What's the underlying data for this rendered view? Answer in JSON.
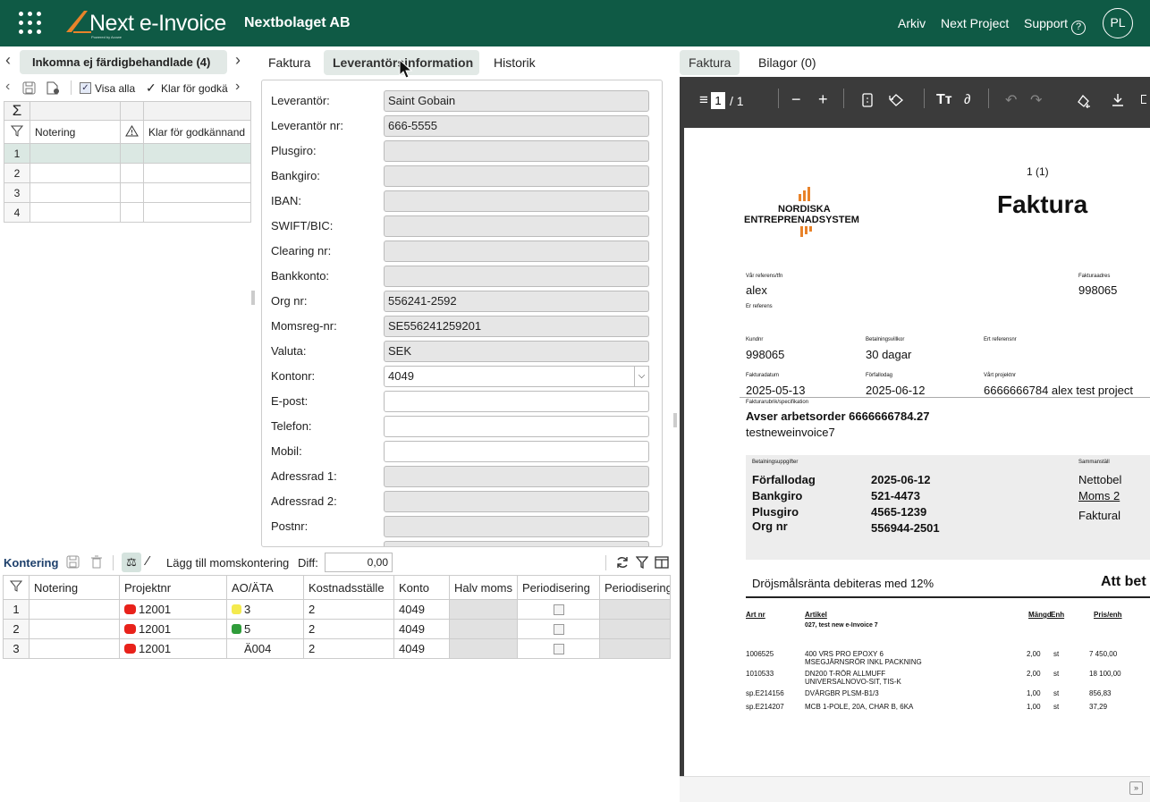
{
  "topbar": {
    "brand": "Next e-Invoice",
    "powered": "Powered by Acowe",
    "company": "Nextbolaget AB",
    "nav": [
      "Arkiv",
      "Next Project",
      "Support"
    ],
    "support_icon": "?",
    "avatar": "PL"
  },
  "left": {
    "tab_label": "Inkomna ej färdigbehandlade (4)",
    "visa_alla": "Visa alla",
    "klar": "Klar för godkä",
    "col_notering": "Notering",
    "col_klar": "Klar för godkännand",
    "sigma": "Σ",
    "rows": [
      "1",
      "2",
      "3",
      "4"
    ]
  },
  "mid": {
    "tabs": [
      "Faktura",
      "Leverantörsinformation",
      "Historik"
    ],
    "fields": [
      {
        "label": "Leverantör:",
        "value": "Saint Gobain",
        "style": "grey"
      },
      {
        "label": "Leverantör nr:",
        "value": "666-5555",
        "style": "grey"
      },
      {
        "label": "Plusgiro:",
        "value": "",
        "style": "grey"
      },
      {
        "label": "Bankgiro:",
        "value": "",
        "style": "grey"
      },
      {
        "label": "IBAN:",
        "value": "",
        "style": "grey"
      },
      {
        "label": "SWIFT/BIC:",
        "value": "",
        "style": "grey"
      },
      {
        "label": "Clearing nr:",
        "value": "",
        "style": "grey"
      },
      {
        "label": "Bankkonto:",
        "value": "",
        "style": "grey"
      },
      {
        "label": "Org nr:",
        "value": "556241-2592",
        "style": "grey"
      },
      {
        "label": "Momsreg-nr:",
        "value": "SE556241259201",
        "style": "grey"
      },
      {
        "label": "Valuta:",
        "value": "SEK",
        "style": "grey"
      },
      {
        "label": "Kontonr:",
        "value": "4049",
        "style": "select"
      },
      {
        "label": "E-post:",
        "value": "",
        "style": "white"
      },
      {
        "label": "Telefon:",
        "value": "",
        "style": "white"
      },
      {
        "label": "Mobil:",
        "value": "",
        "style": "white"
      },
      {
        "label": "Adressrad 1:",
        "value": "",
        "style": "grey"
      },
      {
        "label": "Adressrad 2:",
        "value": "",
        "style": "grey"
      },
      {
        "label": "Postnr:",
        "value": "",
        "style": "grey"
      },
      {
        "label": "Ort:",
        "value": "",
        "style": "grey"
      }
    ]
  },
  "kontering": {
    "title": "Kontering",
    "add_moms": "Lägg till momskontering",
    "diff_label": "Diff:",
    "diff_value": "0,00",
    "headers": [
      "Notering",
      "Projektnr",
      "AO/ÄTA",
      "Kostnadsställe",
      "Konto",
      "Halv moms",
      "Periodisering",
      "Periodisering"
    ],
    "rows": [
      {
        "n": "1",
        "projekt": "12001",
        "projekt_color": "#e8221b",
        "ao": "3",
        "ao_color": "#f4ea4e",
        "kost": "2",
        "konto": "4049"
      },
      {
        "n": "2",
        "projekt": "12001",
        "projekt_color": "#e8221b",
        "ao": "5",
        "ao_color": "#2f9c3a",
        "kost": "2",
        "konto": "4049"
      },
      {
        "n": "3",
        "projekt": "12001",
        "projekt_color": "#e8221b",
        "ao": "Ä004",
        "ao_color": "",
        "kost": "2",
        "konto": "4049"
      }
    ]
  },
  "right": {
    "tabs": [
      "Faktura",
      "Bilagor (0)"
    ],
    "viewer": {
      "page_current": "1",
      "page_total": "/ 1"
    },
    "invoice": {
      "page_of": "1 (1)",
      "title": "Faktura",
      "logo_line1": "NORDISKA",
      "logo_line2": "ENTREPRENADSYSTEM",
      "var_ref_label": "Vår referens/tfn",
      "var_ref": "alex",
      "er_ref_label": "Er referens",
      "fakt_adr_label": "Fakturaadres",
      "fakt_adr": "998065",
      "kundnr_label": "Kundnr",
      "kundnr": "998065",
      "betv_label": "Betalningsvillkor",
      "betv": "30 dagar",
      "ert_ref_label": "Ert referensnr",
      "fdatum_label": "Fakturadatum",
      "fdatum": "2025-05-13",
      "forf_label": "Förfallodag",
      "forf": "2025-06-12",
      "vart_proj_label": "Vårt projektnr",
      "vart_proj": "6666666784 alex test project",
      "rubrik_label": "Fakturarubrik/specifikation",
      "rubrik": "Avser arbetsorder 6666666784.27",
      "rubrik2": "testneweinvoice7",
      "betuppg_label": "Betalningsuppgifter",
      "samm_label": "Sammanställ",
      "pay": [
        {
          "k": "Förfallodag",
          "v": "2025-06-12"
        },
        {
          "k": "Bankgiro",
          "v": "521-4473"
        },
        {
          "k": "Plusgiro",
          "v": "4565-1239"
        },
        {
          "k": "Org nr",
          "v": "556944-2501"
        }
      ],
      "samm": [
        "Nettobel",
        "Moms 2",
        "Faktural"
      ],
      "drojs": "Dröjsmålsränta debiteras med 12%",
      "att_bet": "Att bet",
      "art_headers": [
        "Art nr",
        "Artikel",
        "Mängd",
        "Enh",
        "Pris/enh"
      ],
      "art_sub": "027, test new e-Invoice 7",
      "items": [
        {
          "art": "1006525",
          "name": "400 VRS PRO EPOXY 6",
          "name2": "MSEGJÄRNSRÖR INKL PACKNING",
          "qty": "2,00",
          "enh": "st",
          "pris": "7 450,00"
        },
        {
          "art": "1010533",
          "name": "DN200 T-RÖR ALLMUFF",
          "name2": "UNIVERSALNOVO-SIT, TIS-K",
          "qty": "2,00",
          "enh": "st",
          "pris": "18 100,00"
        },
        {
          "art": "sp.E214156",
          "name": "DVÄRGBR PLSM-B1/3",
          "name2": "",
          "qty": "1,00",
          "enh": "st",
          "pris": "856,83"
        },
        {
          "art": "sp.E214207",
          "name": "MCB 1-POLE, 20A, CHAR B, 6KA",
          "name2": "",
          "qty": "1,00",
          "enh": "st",
          "pris": "37,29"
        }
      ]
    }
  },
  "colors": {
    "header_bg": "#0f5a45",
    "tab_active_bg": "#e2e9e6",
    "accent_orange": "#e8832a"
  }
}
